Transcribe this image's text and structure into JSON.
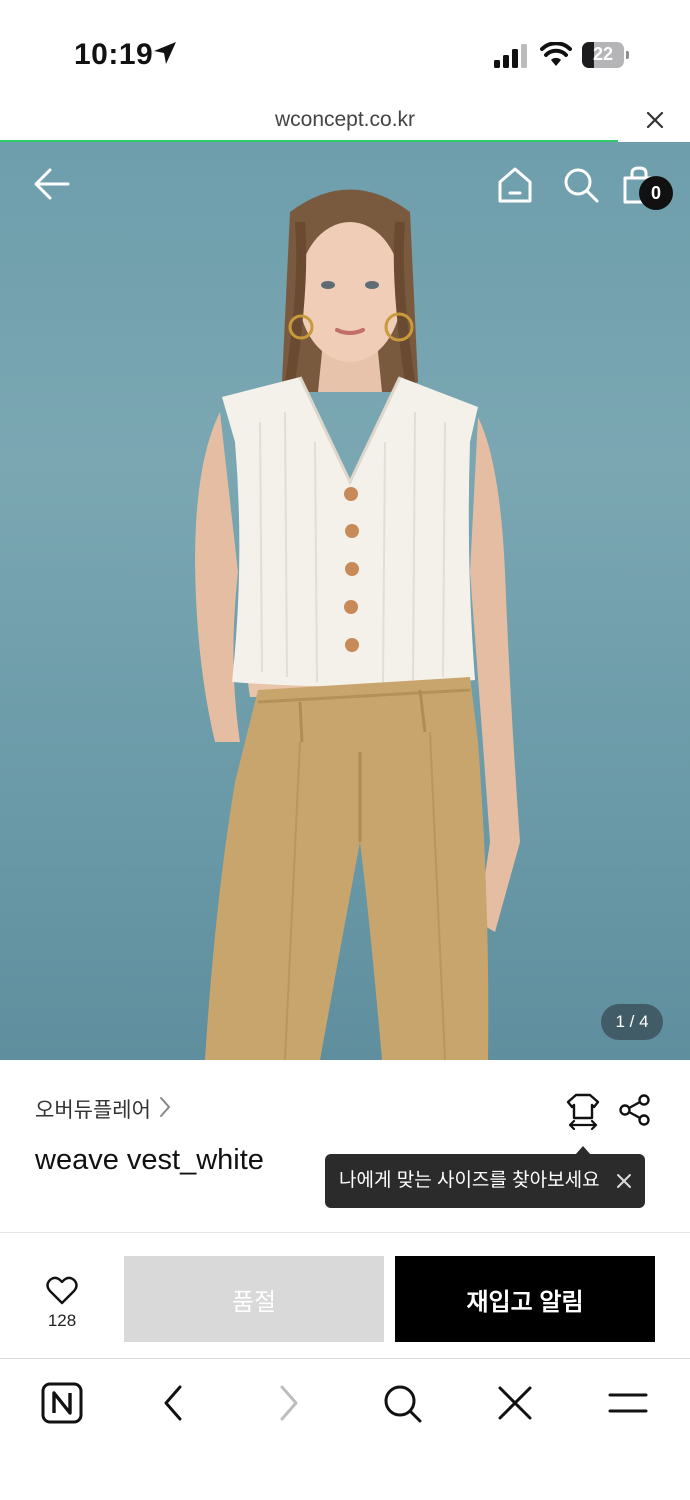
{
  "status_bar": {
    "time": "10:19",
    "battery": "22"
  },
  "browser": {
    "url": "wconcept.co.kr"
  },
  "header": {
    "cart_count": "0"
  },
  "gallery": {
    "counter": "1 / 4"
  },
  "product": {
    "brand": "오버듀플레어",
    "name": "weave vest_white"
  },
  "tooltip": {
    "text": "나에게 맞는 사이즈를 찾아보세요"
  },
  "actions": {
    "like_count": "128",
    "soldout_label": "품절",
    "restock_label": "재입고 알림"
  },
  "colors": {
    "accent_progress": "#2fc96b",
    "background_photo": "#6e9eac",
    "button_primary": "#000000",
    "button_disabled": "#d9d9d9"
  },
  "icons": [
    "location-arrow-icon",
    "signal-icon",
    "wifi-icon",
    "battery-icon",
    "close-icon",
    "back-arrow-icon",
    "home-icon",
    "search-icon",
    "shopping-bag-icon",
    "chevron-right-icon",
    "size-guide-icon",
    "share-icon",
    "heart-icon",
    "naver-logo-icon",
    "menu-icon"
  ]
}
